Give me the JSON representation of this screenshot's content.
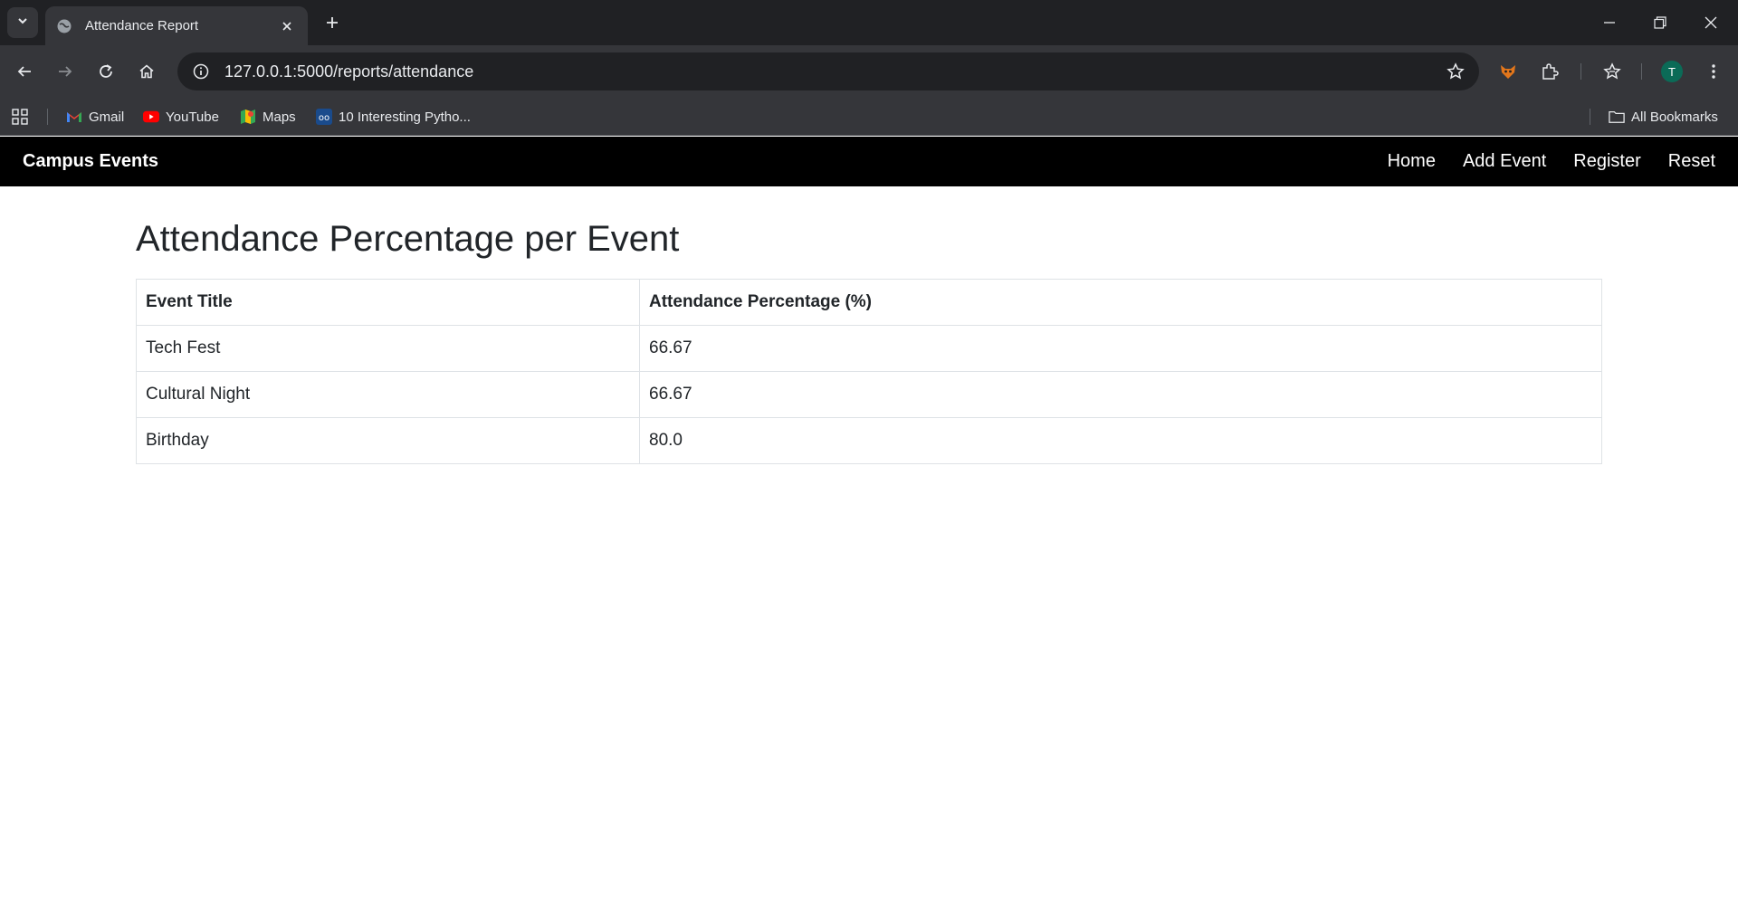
{
  "browser": {
    "tab_title": "Attendance Report",
    "url": "127.0.0.1:5000/reports/attendance",
    "profile_initial": "T",
    "bookmarks": [
      {
        "label": "Gmail",
        "icon": "gmail-icon"
      },
      {
        "label": "YouTube",
        "icon": "youtube-icon"
      },
      {
        "label": "Maps",
        "icon": "maps-icon"
      },
      {
        "label": "10 Interesting Pytho...",
        "icon": "link-icon"
      }
    ],
    "all_bookmarks": "All Bookmarks"
  },
  "navbar": {
    "brand": "Campus Events",
    "links": [
      "Home",
      "Add Event",
      "Register",
      "Reset"
    ]
  },
  "page": {
    "heading": "Attendance Percentage per Event",
    "table": {
      "headers": [
        "Event Title",
        "Attendance Percentage (%)"
      ],
      "rows": [
        [
          "Tech Fest",
          "66.67"
        ],
        [
          "Cultural Night",
          "66.67"
        ],
        [
          "Birthday",
          "80.0"
        ]
      ]
    }
  }
}
